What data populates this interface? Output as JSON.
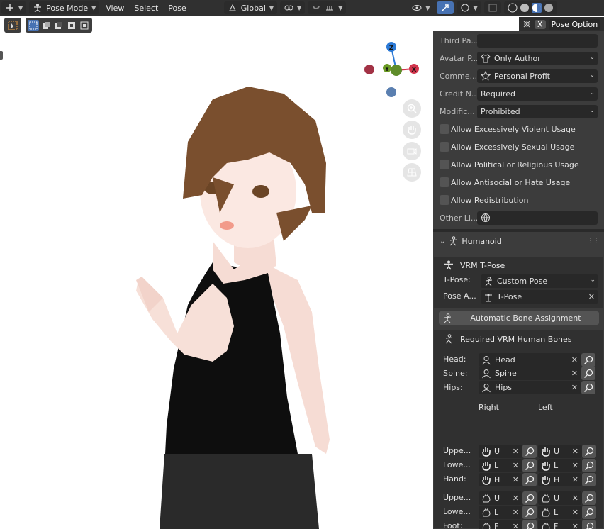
{
  "header": {
    "mode": "Pose Mode",
    "menus": [
      "View",
      "Select",
      "Pose"
    ],
    "orientation": "Global",
    "pose_options": "Pose Options",
    "pose_options_short": "Pose Option"
  },
  "gizmo": {
    "z": "Z",
    "y": "Y",
    "x": "X"
  },
  "meta": {
    "third_party_label": "Third Pa...",
    "third_party_value": "",
    "avatar_label": "Avatar P...",
    "avatar_value": "Only Author",
    "commercial_label": "Comme...",
    "commercial_value": "Personal Profit",
    "credit_label": "Credit N...",
    "credit_value": "Required",
    "modification_label": "Modific...",
    "modification_value": "Prohibited",
    "checkboxes": [
      "Allow Excessively Violent Usage",
      "Allow Excessively Sexual Usage",
      "Allow Political or Religious Usage",
      "Allow Antisocial or Hate Usage",
      "Allow Redistribution"
    ],
    "other_license_label": "Other Li..."
  },
  "humanoid": {
    "title": "Humanoid",
    "tpose_title": "VRM T-Pose",
    "tpose_label": "T-Pose:",
    "tpose_value": "Custom Pose",
    "pose_action_label": "Pose A...",
    "pose_action_value": "T-Pose",
    "auto_button": "Automatic Bone Assignment",
    "required_title": "Required VRM Human Bones",
    "required": [
      {
        "label": "Head:",
        "value": "Head"
      },
      {
        "label": "Spine:",
        "value": "Spine"
      },
      {
        "label": "Hips:",
        "value": "Hips"
      }
    ],
    "right_header": "Right",
    "left_header": "Left",
    "arm_rows": [
      {
        "label": "Uppe...",
        "r": "U",
        "l": "U"
      },
      {
        "label": "Lowe...",
        "r": "L",
        "l": "L"
      },
      {
        "label": "Hand:",
        "r": "H",
        "l": "H"
      }
    ],
    "leg_rows": [
      {
        "label": "Uppe...",
        "r": "U",
        "l": "U"
      },
      {
        "label": "Lowe...",
        "r": "L",
        "l": "L"
      },
      {
        "label": "Foot:",
        "r": "F",
        "l": "F"
      }
    ]
  },
  "colors": {
    "accent": "#4772b3",
    "panel_bg": "#3c3c3c",
    "field_bg": "#282828",
    "gizmo_x": "#d2344c",
    "gizmo_y": "#6a9a24",
    "gizmo_z": "#2c7ad6"
  },
  "icons": [
    "select-box-icon",
    "pose-mode-icon",
    "global-orientation-icon",
    "link-icon",
    "magnet-icon",
    "visibility-icon",
    "gizmo-icon",
    "overlay-icon",
    "shading-icon",
    "zoom-icon",
    "hand-icon",
    "camera-icon",
    "grid-icon",
    "shirt-icon",
    "star-icon",
    "globe-icon",
    "armature-icon",
    "tpose-icon",
    "person-icon",
    "search-icon",
    "hand-bone-icon",
    "foot-icon",
    "close-icon"
  ]
}
